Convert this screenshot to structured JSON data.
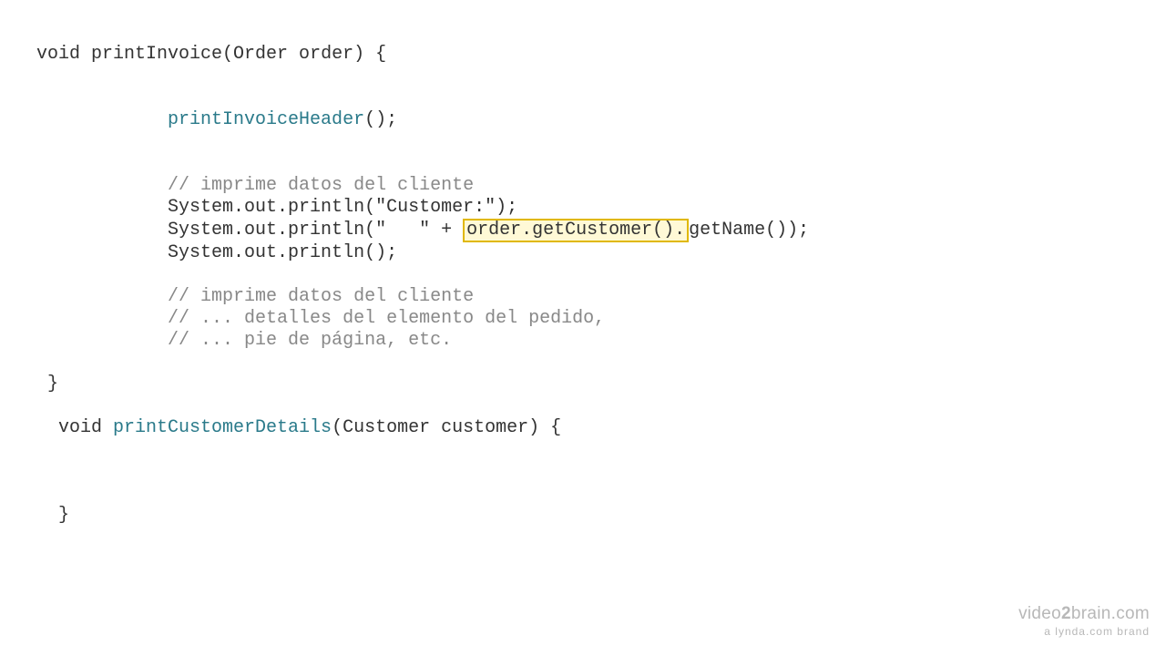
{
  "code": {
    "line1_a": "void ",
    "line1_b": "printInvoice",
    "line1_c": "(Order order) {",
    "line2_indent": "            ",
    "line2_call": "printInvoiceHeader",
    "line2_after": "();",
    "line3_indent": "            ",
    "line3_comment": "// imprime datos del cliente",
    "line4_indent": "            ",
    "line4_text": "System.out.println(\"Customer:\");",
    "line5_indent": "            ",
    "line5_before": "System.out.println(\"   \" + ",
    "line5_highlight": "order.getCustomer().",
    "line5_after": "getName());",
    "line6_indent": "            ",
    "line6_text": "System.out.println();",
    "line7_indent": "            ",
    "line7_comment": "// imprime datos del cliente",
    "line8_indent": "            ",
    "line8_comment": "// ... detalles del elemento del pedido,",
    "line9_indent": "            ",
    "line9_comment": "// ... pie de página, etc.",
    "line10_close": " }",
    "line11_a": "  void ",
    "line11_method": "printCustomerDetails",
    "line11_b": "(Customer customer) {",
    "line12_close": "  }"
  },
  "watermark": {
    "top_a": "video",
    "top_b": "2",
    "top_c": "brain",
    "top_d": ".com",
    "bottom": "a lynda.com brand"
  }
}
